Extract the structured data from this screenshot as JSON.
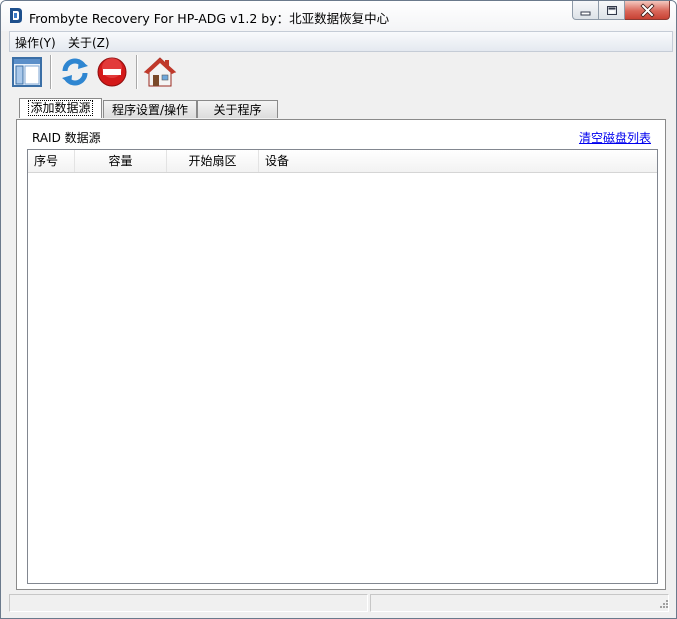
{
  "window": {
    "title": "Frombyte Recovery For HP-ADG v1.2 by：北亚数据恢复中心"
  },
  "menu": {
    "items": [
      {
        "label": "操作(Y)"
      },
      {
        "label": "关于(Z)"
      }
    ]
  },
  "toolbar": {
    "buttons": [
      {
        "icon": "window-layout-icon"
      },
      {
        "icon": "refresh-icon"
      },
      {
        "icon": "stop-icon"
      },
      {
        "icon": "home-icon"
      }
    ]
  },
  "tabs": [
    {
      "label": "添加数据源",
      "active": true
    },
    {
      "label": "程序设置/操作",
      "active": false
    },
    {
      "label": "关于程序",
      "active": false
    }
  ],
  "panel": {
    "source_label": "RAID 数据源",
    "clear_link": "清空磁盘列表",
    "columns": [
      "序号",
      "容量",
      "开始扇区",
      "设备"
    ],
    "rows": []
  },
  "colors": {
    "link": "#0000ee",
    "close_button": "#c84234",
    "refresh_blue": "#2f86d1",
    "stop_red": "#d41a1a",
    "home_red": "#c0392b"
  }
}
